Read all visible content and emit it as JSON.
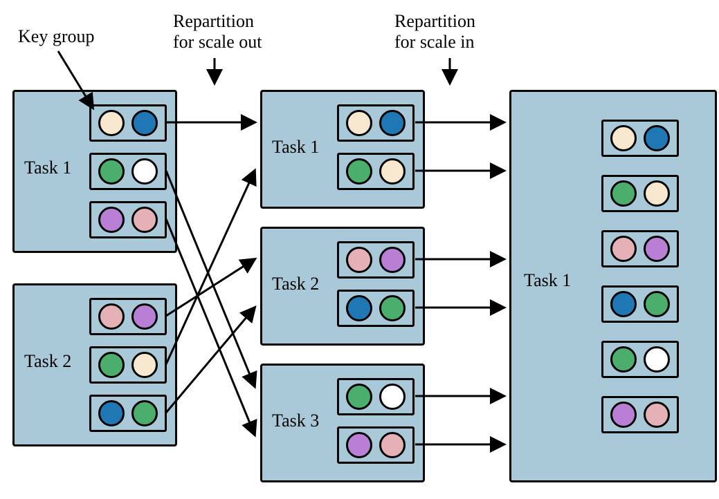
{
  "labels": {
    "key_group": "Key group",
    "repartition_out_l1": "Repartition",
    "repartition_out_l2": "for scale out",
    "repartition_in_l1": "Repartition",
    "repartition_in_l2": "for scale in"
  },
  "columns": {
    "left": {
      "tasks": [
        {
          "name": "Task 1",
          "groups": [
            [
              "cream",
              "blue"
            ],
            [
              "green",
              "white"
            ],
            [
              "purple",
              "pink"
            ]
          ]
        },
        {
          "name": "Task 2",
          "groups": [
            [
              "pink",
              "purple"
            ],
            [
              "green",
              "cream"
            ],
            [
              "blue",
              "green"
            ]
          ]
        }
      ]
    },
    "middle": {
      "tasks": [
        {
          "name": "Task 1",
          "groups": [
            [
              "cream",
              "blue"
            ],
            [
              "green",
              "cream"
            ]
          ]
        },
        {
          "name": "Task 2",
          "groups": [
            [
              "pink",
              "purple"
            ],
            [
              "blue",
              "green"
            ]
          ]
        },
        {
          "name": "Task 3",
          "groups": [
            [
              "green",
              "white"
            ],
            [
              "purple",
              "pink"
            ]
          ]
        }
      ]
    },
    "right": {
      "tasks": [
        {
          "name": "Task 1",
          "groups": [
            [
              "cream",
              "blue"
            ],
            [
              "green",
              "cream"
            ],
            [
              "pink",
              "purple"
            ],
            [
              "blue",
              "green"
            ],
            [
              "green",
              "white"
            ],
            [
              "purple",
              "pink"
            ]
          ]
        }
      ]
    }
  }
}
